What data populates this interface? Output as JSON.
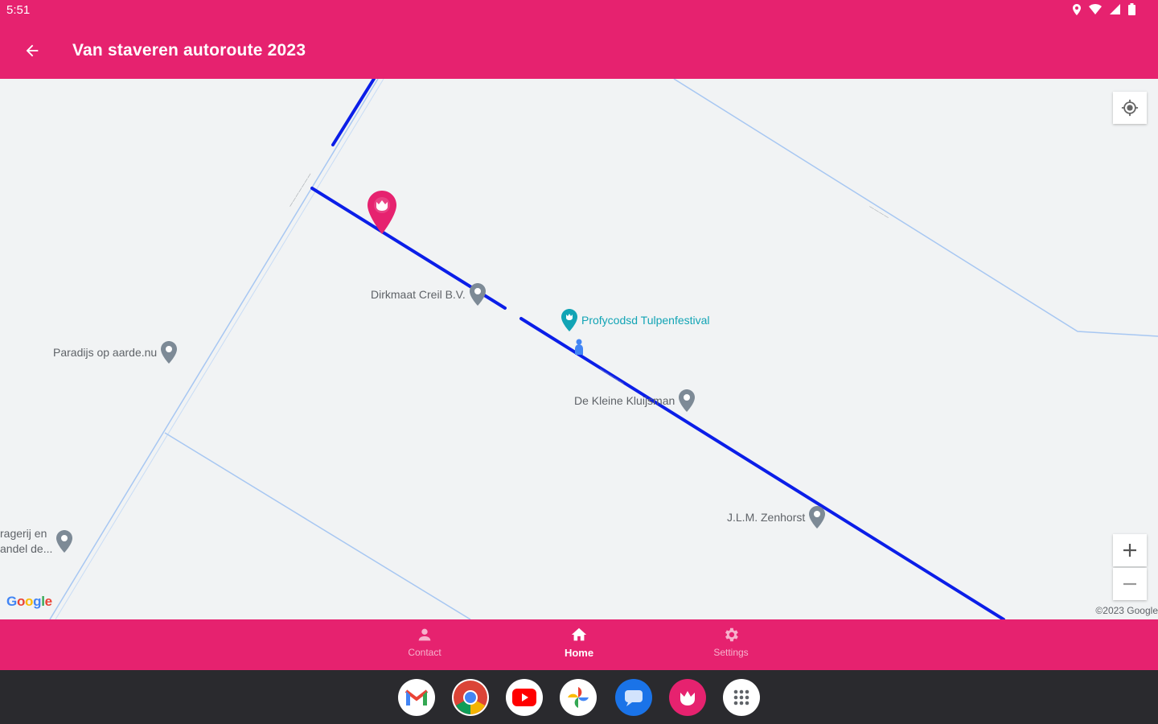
{
  "status_bar": {
    "time": "5:51",
    "icons": [
      "location-icon",
      "wifi-icon",
      "signal-icon",
      "battery-icon"
    ]
  },
  "app_bar": {
    "title": "Van staveren autoroute 2023",
    "back_icon": "arrow-left-icon"
  },
  "colors": {
    "brand": "#e6226f",
    "route": "#0b1ee8",
    "map_background": "#f1f3f4",
    "taskbar": "#2a2a2e"
  },
  "map": {
    "pois": [
      {
        "name": "Dirkmaat Creil B.V."
      },
      {
        "name": "Profycodsd Tulpenfestival"
      },
      {
        "name": "Paradijs op aarde.nu"
      },
      {
        "name": "De Kleine Kluijsman"
      },
      {
        "name": "J.L.M. Zenhorst"
      },
      {
        "name": "ragerij en\nandel de..."
      }
    ],
    "logo": [
      "G",
      "o",
      "o",
      "g",
      "l",
      "e"
    ],
    "copyright": "©2023 Google"
  },
  "bottom_nav": {
    "items": [
      {
        "label": "Contact",
        "icon": "person-icon"
      },
      {
        "label": "Home",
        "icon": "home-icon",
        "active": true
      },
      {
        "label": "Settings",
        "icon": "gear-icon"
      }
    ]
  },
  "dock": {
    "apps": [
      "gmail-icon",
      "chrome-icon",
      "youtube-icon",
      "photos-icon",
      "messages-icon",
      "tulip-app-icon",
      "app-drawer-icon"
    ]
  }
}
